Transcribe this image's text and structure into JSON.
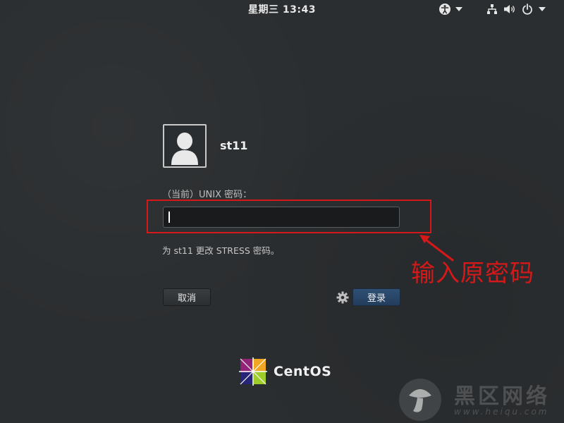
{
  "topbar": {
    "clock": "星期三 13:43",
    "icons": [
      "accessibility-icon",
      "chevron-down-icon",
      "network-icon",
      "volume-icon",
      "power-icon",
      "chevron-down-icon"
    ]
  },
  "login": {
    "username": "st11",
    "prompt": "（当前）UNIX 密码：",
    "password_value": "",
    "message": "为 st11 更改 STRESS 密码。",
    "cancel_label": "取消",
    "login_label": "登录"
  },
  "annotation": {
    "text": "输入原密码",
    "color": "#d61818"
  },
  "branding": {
    "centos": "CentOS",
    "watermark_title": "黑区网络",
    "watermark_url": "www.heiqu.com"
  },
  "colors": {
    "background": "#2b2e30",
    "login_button": "#2a4769",
    "highlight": "#d61818"
  }
}
